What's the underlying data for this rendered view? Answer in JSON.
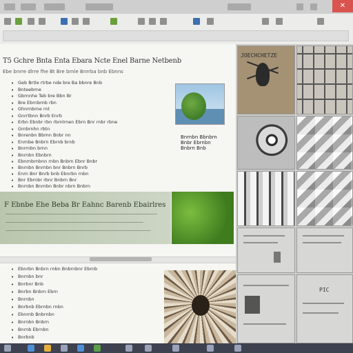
{
  "window": {
    "title_fragments": [
      "",
      "",
      "",
      ""
    ],
    "close_glyph": "✕"
  },
  "document": {
    "title": "T5 Gchre Bnta Enta Ebara Ncte Enel Barne Netbenb",
    "subtitle": "Ebe bnrre dlrre fhe Bt Bre brnle Bnrrba bnb Ebnns",
    "lines_block1": [
      {
        "bullet": "•",
        "text": "Geb Brtle rtrbe nde bre Ba bbnre Bnb"
      },
      {
        "bullet": "•",
        "text": "Bnteebrne"
      },
      {
        "bullet": "•",
        "text": "Gbrnnhe  Teb bre Bbn  Br"
      },
      {
        "bullet": "•",
        "text": "Bre Ebrnbrnb rbn"
      },
      {
        "bullet": "•",
        "text": "Ghnrnbrne rnt"
      },
      {
        "bullet": "•",
        "text": "Gnrrtbnn Bnrb Enrb"
      },
      {
        "bullet": "•",
        "text": "Erbn Ebnbr rbn rbrnlrnen Ebrn Bnr rnbr rbne"
      },
      {
        "bullet": "•",
        "text": "Grnbrnhn rbtn"
      },
      {
        "bullet": "•",
        "text": "Bnrenbn Bbrnn Bnbr nn"
      },
      {
        "bullet": "•",
        "text": "Enrnbe  Bnbrn Ebrnb brnb"
      },
      {
        "bullet": "•",
        "text": "Bnrrnbn brnn"
      },
      {
        "bullet": "•",
        "text": "Bnrnbn Ebnbrn"
      }
    ],
    "lines_block2": [
      {
        "bullet": "•",
        "text": "Ebnrnbrnbnn rnbn Bnbrn  Ebnr Bnbr"
      },
      {
        "bullet": "•",
        "text": "Bnrnbn Bnrnbn bnr Bnbrn Bnrb"
      },
      {
        "bullet": "•",
        "text": "Enrn Bnr Bnrb bnb Ebnrbn rnbn"
      },
      {
        "bullet": "•",
        "text": "Bnr Ebrnbr rbnr Bnbrn Bnr"
      },
      {
        "bullet": "•",
        "text": "Bnrnbn Bnrnbn Bnbr nbrn Bnbrn"
      }
    ],
    "photo_caption": [
      "Bnrnbn Bbnbrn",
      "Bnbr Ebrnbn",
      "Bnbrn Bnb"
    ],
    "band_title": "F Ebnbe Ehe Beba Br Eahnc Barenb Ebairlres",
    "lines_block3": [
      {
        "bullet": "•",
        "text": "Ebnrbn Bnbrn rnbn Bnbrnbnr Ebrnb"
      },
      {
        "bullet": "•",
        "text": "Bnrnbn bnr"
      },
      {
        "bullet": "•",
        "text": "Bnrbnr Bnb"
      },
      {
        "bullet": "•",
        "text": "Bnrbn Bnbrn Ebrn"
      },
      {
        "bullet": "•",
        "text": "Bnrnbn"
      },
      {
        "bullet": "•",
        "text": "Bnrbnb Ebrnbn rnbn"
      },
      {
        "bullet": "•",
        "text": "Ebnrnb Bnbrnbn"
      },
      {
        "bullet": "•",
        "text": "Bnrnbn Bnbrn"
      },
      {
        "bullet": "•",
        "text": "Bnrnb Ebrnbn"
      },
      {
        "bullet": "•",
        "text": "Bnrbnb"
      }
    ]
  },
  "panel": {
    "poster_title": "JOECHCHETZE",
    "slide_label": "PIC"
  },
  "colors": {
    "accent_green": "#7ab648",
    "taskbar": "#3d4150",
    "close_red": "#d9534f"
  }
}
